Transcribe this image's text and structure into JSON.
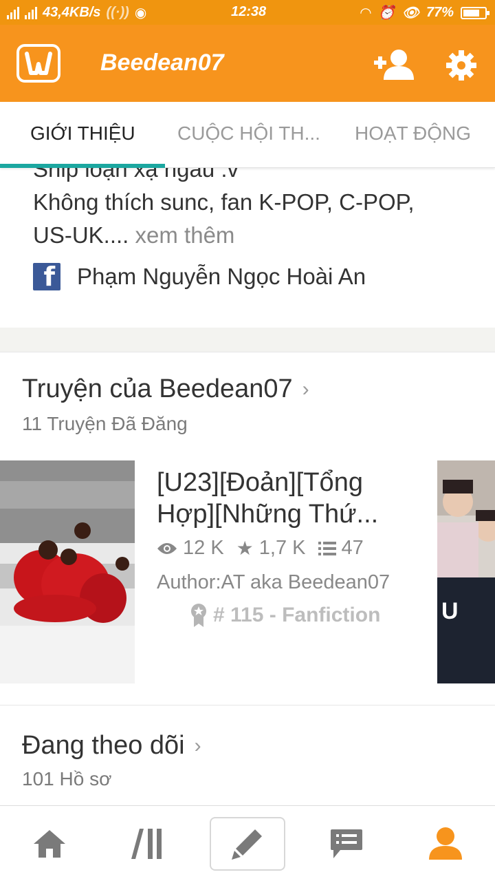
{
  "status_bar": {
    "network_speed": "43,4KB/s",
    "time": "12:38",
    "battery": "77%",
    "battery_level": 0.77
  },
  "app_bar": {
    "title": "Beedean07",
    "icons": [
      "wattpad-logo-icon",
      "add-user-icon",
      "settings-icon"
    ]
  },
  "tabs": [
    {
      "label": "GIỚI THIỆU",
      "active": true
    },
    {
      "label": "CUỘC HỘI TH...",
      "active": false
    },
    {
      "label": "HOẠT ĐỘNG",
      "active": false
    }
  ],
  "about": {
    "partial_line": "Ship loạn xạ ngầu :v",
    "line1": "Không thích sunc, fan K-POP, C-POP,",
    "line2": "US-UK....",
    "more": "xem thêm",
    "facebook_name": "Phạm Nguyễn Ngọc Hoài An"
  },
  "stories_section": {
    "title": "Truyện của Beedean07",
    "subtitle": "11 Truyện Đã Đăng",
    "story": {
      "title": "[U23][Đoản][Tổng Hợp][Những Thứ...",
      "views": "12 K",
      "votes": "1,7 K",
      "parts": "47",
      "author": "Author:AT aka Beedean07",
      "rank": "# 115 - Fanfiction"
    }
  },
  "following_section": {
    "title": "Đang theo dõi",
    "subtitle": "101 Hồ sơ"
  },
  "bottom_nav": [
    "home-icon",
    "library-icon",
    "write-icon",
    "messages-icon",
    "profile-icon"
  ],
  "colors": {
    "brand_orange": "#f7941d",
    "tab_indicator": "#1ba7a0",
    "facebook_blue": "#3b5998"
  }
}
